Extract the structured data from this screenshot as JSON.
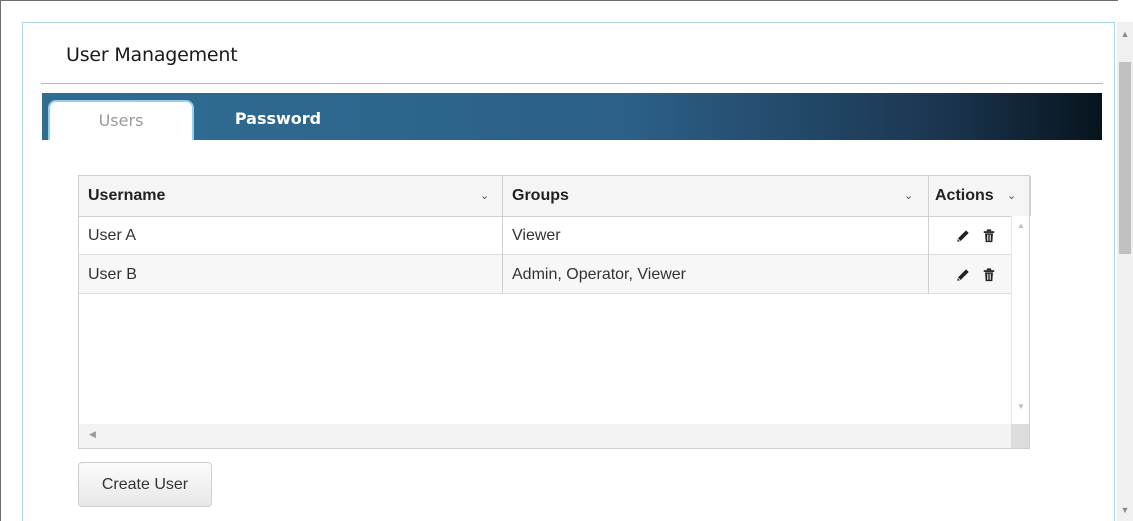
{
  "panel": {
    "title": "User Management"
  },
  "tabs": [
    {
      "label": "Users",
      "active": true
    },
    {
      "label": "Password",
      "active": false
    }
  ],
  "grid": {
    "columns": [
      {
        "label": "Username"
      },
      {
        "label": "Groups"
      },
      {
        "label": "Actions"
      }
    ],
    "rows": [
      {
        "username": "User A",
        "groups": "Viewer"
      },
      {
        "username": "User B",
        "groups": "Admin, Operator, Viewer"
      }
    ]
  },
  "buttons": {
    "create_user": "Create User"
  },
  "icons": {
    "column_menu": "chevron-down-icon",
    "edit": "pencil-icon",
    "delete": "trash-icon",
    "scroll_up": "triangle-up-icon",
    "scroll_down": "triangle-down-icon",
    "scroll_left": "triangle-left-icon",
    "scroll_right": "triangle-right-icon"
  },
  "colors": {
    "accent_border": "#86c9df",
    "tabbar_start": "#2f6d94",
    "tabbar_end": "#07141d",
    "active_tab_text": "#9a9a9a"
  }
}
